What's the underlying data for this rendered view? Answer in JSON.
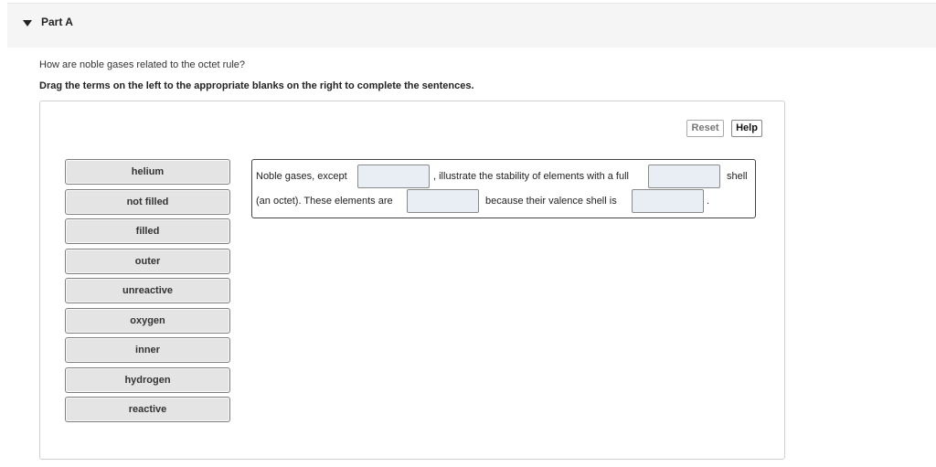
{
  "part": {
    "title": "Part A"
  },
  "question": "How are noble gases related to the octet rule?",
  "instruction": "Drag the terms on the left to the appropriate blanks on the right to complete the sentences.",
  "toolbar": {
    "reset_label": "Reset",
    "help_label": "Help"
  },
  "terms": [
    "helium",
    "not filled",
    "filled",
    "outer",
    "unreactive",
    "oxygen",
    "inner",
    "hydrogen",
    "reactive"
  ],
  "sentence": {
    "seg1": "Noble gases, except",
    "seg2": ", illustrate the stability of elements with a full",
    "seg3": "shell",
    "seg4": "(an octet). These elements are",
    "seg5": "because their valence shell is",
    "seg6": "."
  },
  "colors": {
    "blank_fill": "#e9eef4",
    "term_fill": "#e4e4e4",
    "header_bg": "#f5f5f5"
  }
}
